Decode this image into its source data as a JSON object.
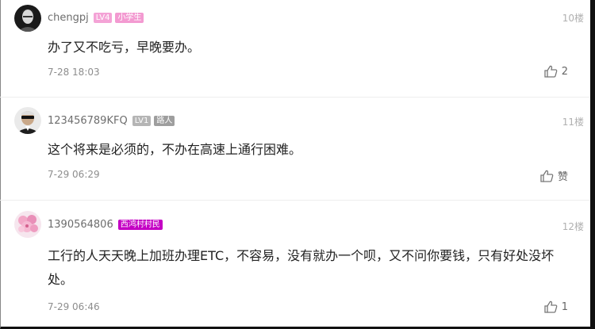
{
  "comments": [
    {
      "username": "chengpj",
      "level_badge": "LV4",
      "title_badge": "小学生",
      "floor": "10楼",
      "content": "办了又不吃亏，早晚要办。",
      "date": "7-28 18:03",
      "likes": "2"
    },
    {
      "username": "123456789KFQ",
      "level_badge": "LV1",
      "title_badge": "路人",
      "floor": "11楼",
      "content": "这个将来是必须的，不办在高速上通行困难。",
      "date": "7-29 06:29",
      "likes": "赞"
    },
    {
      "username": "1390564806",
      "title_badge": "西鸿村村民",
      "floor": "12楼",
      "content": "工行的人天天晚上加班办理ETC，不容易，没有就办一个呗，又不问你要钱，只有好处没坏处。",
      "date": "7-29 06:46",
      "likes": "1"
    }
  ],
  "icons": {
    "like": "thumbs-up-icon"
  },
  "colors": {
    "lv4_badge": "#f4a3d6",
    "title_badge_pink": "#f39ad1",
    "lv1_badge": "#b5b5b5",
    "title_badge_gray": "#9e9e9e",
    "title_badge_purple": "#c400c4"
  }
}
